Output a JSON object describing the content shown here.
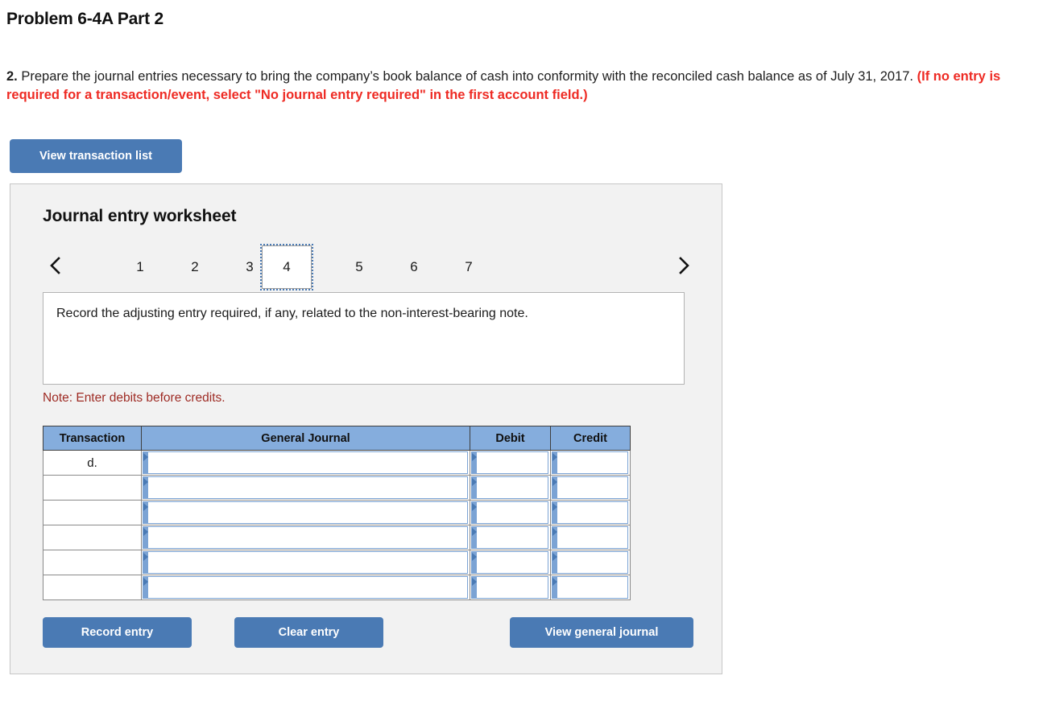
{
  "page_title": "Problem 6-4A Part 2",
  "prompt": {
    "number": "2.",
    "body": " Prepare the journal entries necessary to bring the company’s book balance of cash into conformity with the reconciled cash balance as of July 31, 2017. ",
    "red_note": "(If no entry is required for a transaction/event, select \"No journal entry required\" in the first account field.)"
  },
  "view_transaction_list_label": "View transaction list",
  "worksheet": {
    "title": "Journal entry worksheet",
    "prev_icon": "chevron-left-icon",
    "next_icon": "chevron-right-icon",
    "tabs": [
      {
        "label": "1",
        "active": false
      },
      {
        "label": "2",
        "active": false
      },
      {
        "label": "3",
        "active": false
      },
      {
        "label": "4",
        "active": true
      },
      {
        "label": "5",
        "active": false
      },
      {
        "label": "6",
        "active": false
      },
      {
        "label": "7",
        "active": false
      }
    ],
    "active_tab": "4",
    "description": "Record the adjusting entry required, if any, related to the non-interest-bearing note.",
    "note": "Note: Enter debits before credits.",
    "table": {
      "columns": [
        "Transaction",
        "General Journal",
        "Debit",
        "Credit"
      ],
      "rows": [
        {
          "transaction": "d.",
          "general_journal": "",
          "debit": "",
          "credit": ""
        },
        {
          "transaction": "",
          "general_journal": "",
          "debit": "",
          "credit": ""
        },
        {
          "transaction": "",
          "general_journal": "",
          "debit": "",
          "credit": ""
        },
        {
          "transaction": "",
          "general_journal": "",
          "debit": "",
          "credit": ""
        },
        {
          "transaction": "",
          "general_journal": "",
          "debit": "",
          "credit": ""
        },
        {
          "transaction": "",
          "general_journal": "",
          "debit": "",
          "credit": ""
        }
      ]
    },
    "buttons": {
      "record_entry": "Record entry",
      "clear_entry": "Clear entry",
      "view_general_journal": "View general journal"
    }
  },
  "colors": {
    "button_blue": "#4a7ab4",
    "table_header_blue": "#85addd",
    "red_note": "#ee2a23",
    "note_maroon": "#9e2b24",
    "panel_gray": "#f2f2f2"
  }
}
